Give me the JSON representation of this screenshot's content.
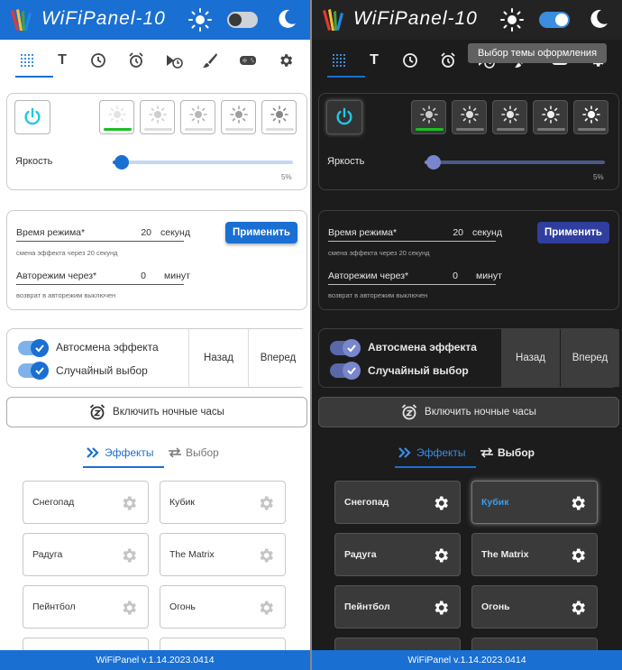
{
  "app_title": "WiFiPanel-10",
  "tooltip": "Выбор темы оформления",
  "tab_text_glyph": "T",
  "brightness": {
    "label": "Яркость",
    "value_text": "5%",
    "fraction": 0.05,
    "selected_preset": 1,
    "preset_count": 5
  },
  "mode": {
    "duration_label": "Время режима*",
    "duration_value": "20",
    "duration_unit": "секунд",
    "duration_hint": "смена эффекта через 20 секунд",
    "auto_label": "Авторежим через*",
    "auto_value": "0",
    "auto_unit": "минут",
    "auto_hint": "возврат в авторежим выключен",
    "apply": "Применить"
  },
  "switches": {
    "auto_change": "Автосмена эффекта",
    "random": "Случайный выбор",
    "back": "Назад",
    "forward": "Вперед"
  },
  "night_clock": "Включить ночные часы",
  "effect_tabs": {
    "effects": "Эффекты",
    "choice": "Выбор"
  },
  "effects": [
    "Снегопад",
    "Кубик",
    "Радуга",
    "The Matrix",
    "Пейнтбол",
    "Огонь"
  ],
  "footer": "WiFiPanel v.1.14.2023.0414",
  "colors": {
    "accent": "#1a6fd2",
    "dark_bg": "#1c1c1c",
    "selected_bar": "#1bbf22"
  }
}
